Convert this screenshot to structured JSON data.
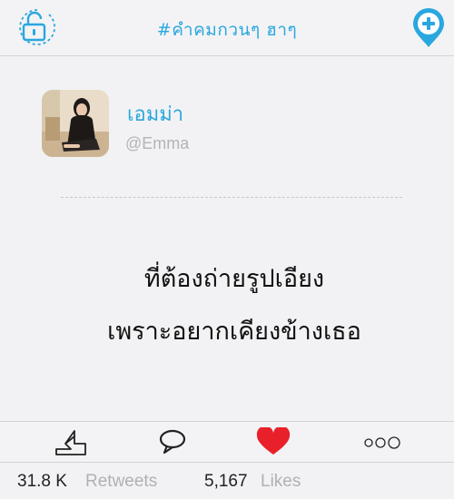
{
  "header": {
    "title": "#คำคมกวนๆ ฮาๆ",
    "left_icon": "unlock-icon",
    "right_icon": "add-location-icon",
    "accent": "#29a7df"
  },
  "profile": {
    "display_name": "เอมม่า",
    "handle": "@Emma",
    "avatar": "profile-photo"
  },
  "post": {
    "lines": [
      "ที่ต้องถ่ายรูปเอียง",
      "เพราะอยากเคียงข้างเธอ"
    ]
  },
  "actions": {
    "share_icon": "share-icon",
    "comment_icon": "comment-icon",
    "like_icon": "heart-icon",
    "more_icon": "more-icon",
    "like_color": "#e8202a"
  },
  "stats": {
    "retweets_count": "31.8 K",
    "retweets_label": "Retweets",
    "likes_count": "5,167",
    "likes_label": "Likes"
  }
}
